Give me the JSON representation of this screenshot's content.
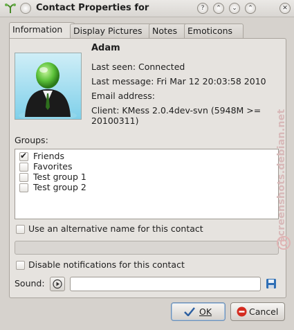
{
  "window": {
    "title": "Contact Properties for"
  },
  "tabs": [
    {
      "label": "Information"
    },
    {
      "label": "Display Pictures"
    },
    {
      "label": "Notes"
    },
    {
      "label": "Emoticons"
    }
  ],
  "contact": {
    "name": "Adam",
    "last_seen": "Last seen: Connected",
    "last_message": "Last message: Fri Mar 12 20:03:58 2010",
    "email": "Email address:",
    "client_line1": "Client: KMess 2.0.4dev-svn (5948M >=",
    "client_line2": "20100311)"
  },
  "groups": {
    "label": "Groups:",
    "items": [
      {
        "label": "Friends",
        "checked": true
      },
      {
        "label": "Favorites",
        "checked": false
      },
      {
        "label": "Test group 1",
        "checked": false
      },
      {
        "label": "Test group 2",
        "checked": false
      }
    ]
  },
  "options": {
    "alt_name": "Use an alternative name for this contact",
    "alt_name_value": "",
    "disable_notifications": "Disable notifications for this contact",
    "sound_label": "Sound:",
    "sound_value": ""
  },
  "buttons": {
    "ok": "OK",
    "cancel": "Cancel"
  },
  "watermark": "screenshots.debian.net"
}
